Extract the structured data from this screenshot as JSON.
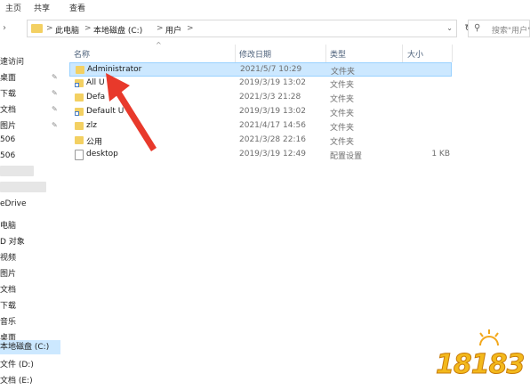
{
  "ribbon": {
    "tabs": [
      "主页",
      "共享",
      "查看"
    ]
  },
  "address": {
    "segments": [
      "此电脑",
      "本地磁盘 (C:)",
      "用户"
    ],
    "separator": ">"
  },
  "search": {
    "placeholder": "搜索\"用户\""
  },
  "sidebar": {
    "items": [
      "速访问",
      "桌面",
      "下载",
      "文档",
      "图片",
      "506",
      "506",
      "eDrive",
      "电脑",
      "D 对象",
      "视频",
      "图片",
      "文档",
      "下载",
      "音乐",
      "桌面",
      "本地磁盘 (C:)",
      "文件 (D:)",
      "文档 (E:)"
    ]
  },
  "columns": {
    "name": "名称",
    "date": "修改日期",
    "type": "类型",
    "size": "大小"
  },
  "files": [
    {
      "name": "Administrator",
      "date": "2021/5/7 10:29",
      "type": "文件夹",
      "size": "",
      "icon": "folder-icon"
    },
    {
      "name": "All U",
      "date": "2019/3/19 13:02",
      "type": "文件夹",
      "size": "",
      "icon": "folder-shortcut-icon"
    },
    {
      "name": "Defa",
      "date": "2021/3/3 21:28",
      "type": "文件夹",
      "size": "",
      "icon": "folder-icon"
    },
    {
      "name": "Default U",
      "date": "2019/3/19 13:02",
      "type": "文件夹",
      "size": "",
      "icon": "folder-shortcut-icon"
    },
    {
      "name": "zlz",
      "date": "2021/4/17 14:56",
      "type": "文件夹",
      "size": "",
      "icon": "folder-icon"
    },
    {
      "name": "公用",
      "date": "2021/3/28 22:16",
      "type": "文件夹",
      "size": "",
      "icon": "folder-icon"
    },
    {
      "name": "desktop",
      "date": "2019/3/19 12:49",
      "type": "配置设置",
      "size": "1 KB",
      "icon": "settings-file-icon"
    }
  ],
  "watermark": {
    "text": "18183"
  },
  "colors": {
    "selection": "#cce8ff",
    "arrow": "#e8392b",
    "folder": "#f3d062"
  }
}
